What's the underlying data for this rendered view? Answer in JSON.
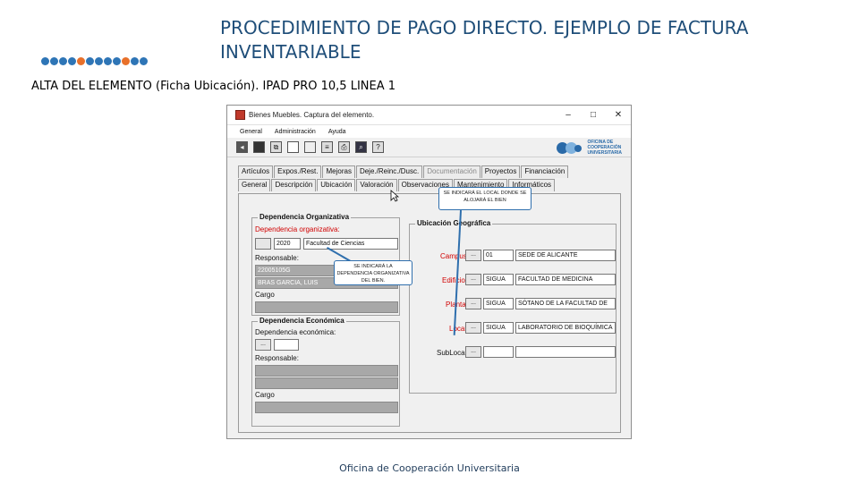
{
  "slide": {
    "title": "PROCEDIMIENTO DE PAGO DIRECTO. EJEMPLO DE FACTURA INVENTARIABLE",
    "subtitle": "ALTA DEL ELEMENTO (Ficha Ubicación). IPAD PRO 10,5 LINEA 1",
    "footer": "Oficina de Cooperación Universitaria",
    "dot_colors": [
      "#2e75b6",
      "#2e75b6",
      "#2e75b6",
      "#2e75b6",
      "#e8702a",
      "#2e75b6",
      "#2e75b6",
      "#2e75b6",
      "#2e75b6",
      "#e8702a",
      "#2e75b6",
      "#2e75b6"
    ]
  },
  "window": {
    "title": "Bienes Muebles. Captura del elemento.",
    "controls": {
      "minimize": "–",
      "maximize": "□",
      "close": "✕"
    },
    "menu": [
      "General",
      "Administración",
      "Ayuda"
    ],
    "logo_text": [
      "OFICINA DE",
      "COOPERACIÓN",
      "UNIVERSITARIA"
    ],
    "tabs_row1": [
      {
        "label": "Artículos"
      },
      {
        "label": "Expos./Rest."
      },
      {
        "label": "Mejoras"
      },
      {
        "label": "Deje./Reinc./Dusc."
      },
      {
        "label": "Documentación"
      },
      {
        "label": "Proyectos"
      },
      {
        "label": "Financiación"
      }
    ],
    "tabs_row2": [
      {
        "label": "General"
      },
      {
        "label": "Descripción"
      },
      {
        "label": "Ubicación"
      },
      {
        "label": "Valoración"
      },
      {
        "label": "Observaciones"
      },
      {
        "label": "Mantenimiento"
      },
      {
        "label": "Informáticos"
      }
    ]
  },
  "organizativa": {
    "title": "Dependencia Organizativa",
    "dep_label": "Dependencia organizativa:",
    "dep_code": "2020",
    "dep_name": "Facultad de Ciencias",
    "resp_label": "Responsable:",
    "resp_id": "22005105G",
    "resp_name": "BRAS GARCIA, LUIS",
    "cargo_label": "Cargo"
  },
  "economica": {
    "title": "Dependencia Económica",
    "dep_label": "Dependencia económica:",
    "resp_label": "Responsable:",
    "cargo_label": "Cargo",
    "btn_label": "..."
  },
  "geografica": {
    "title": "Ubicación Geográfica",
    "rows": [
      {
        "label": "Campus",
        "code": "01",
        "value": "SEDE DE ALICANTE"
      },
      {
        "label": "Edificio",
        "code": "SIGUA",
        "value": "FACULTAD DE MEDICINA"
      },
      {
        "label": "Planta",
        "code": "SIGUA",
        "value": "SÓTANO DE LA FACULTAD DE"
      },
      {
        "label": "Local",
        "code": "SIGUA",
        "value": "LABORATORIO DE BIOQUÍMICA"
      },
      {
        "label": "SubLocal",
        "code": "",
        "value": ""
      }
    ],
    "btn_label": "..."
  },
  "callouts": {
    "local": "SE INDICARÁ EL LOCAL DONDE SE ALOJARÁ EL BIEN",
    "dependencia": "SE INDICARÁ LA DEPENDENCIA ORGANIZATIVA DEL BIEN."
  },
  "colors": {
    "accent_blue": "#2f6fad",
    "required_red": "#d00000",
    "title_blue": "#1f4e79"
  }
}
